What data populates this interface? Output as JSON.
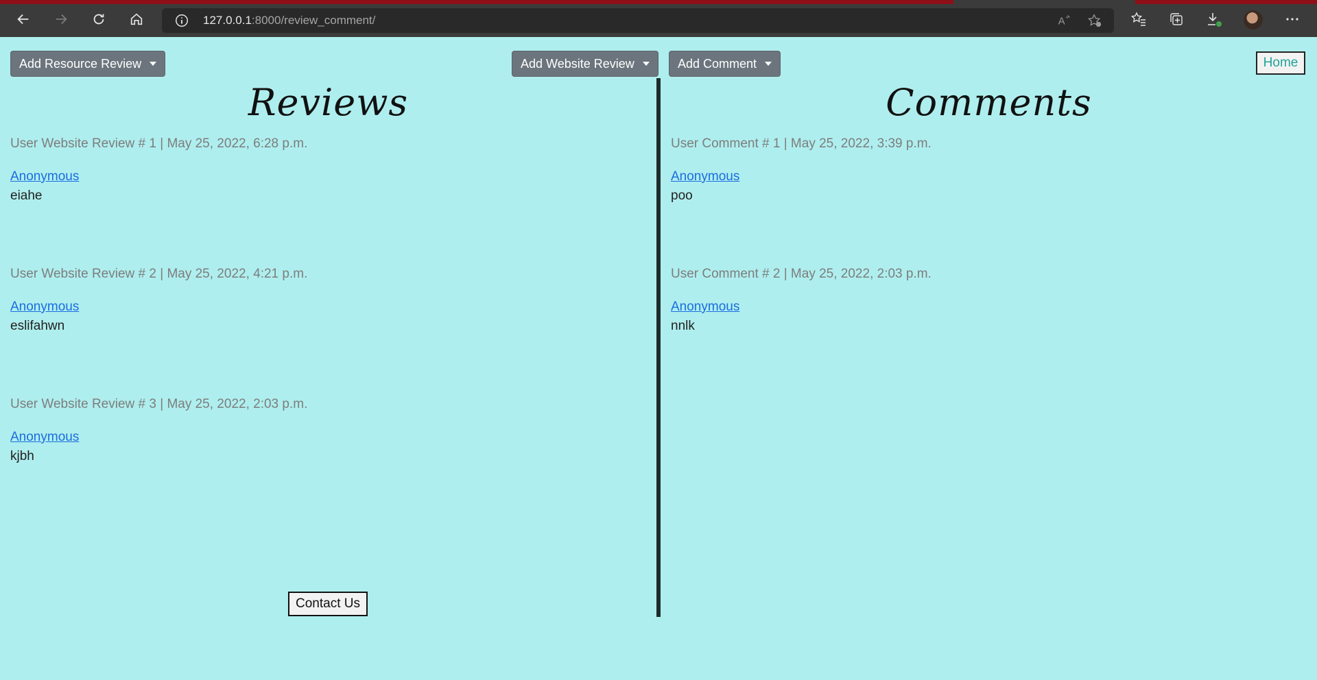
{
  "browser": {
    "url_host": "127.0.0.1",
    "url_rest": ":8000/review_comment/"
  },
  "toolbar": {
    "add_resource_review": "Add Resource Review",
    "add_website_review": "Add Website Review",
    "add_comment": "Add Comment",
    "home": "Home"
  },
  "reviews": {
    "title": "Reviews",
    "items": [
      {
        "meta": "User Website Review # 1 | May 25, 2022, 6:28 p.m.",
        "author": "Anonymous",
        "body": "eiahe"
      },
      {
        "meta": "User Website Review # 2 | May 25, 2022, 4:21 p.m.",
        "author": "Anonymous",
        "body": "eslifahwn"
      },
      {
        "meta": "User Website Review # 3 | May 25, 2022, 2:03 p.m.",
        "author": "Anonymous",
        "body": "kjbh"
      }
    ]
  },
  "comments": {
    "title": "Comments",
    "items": [
      {
        "meta": "User Comment # 1 | May 25, 2022, 3:39 p.m.",
        "author": "Anonymous",
        "body": "poo"
      },
      {
        "meta": "User Comment # 2 | May 25, 2022, 2:03 p.m.",
        "author": "Anonymous",
        "body": "nnlk"
      }
    ]
  },
  "footer": {
    "contact": "Contact Us"
  },
  "colors": {
    "page_bg": "#afeeee",
    "button_bg": "#6c757d",
    "link": "#1a6de0"
  }
}
